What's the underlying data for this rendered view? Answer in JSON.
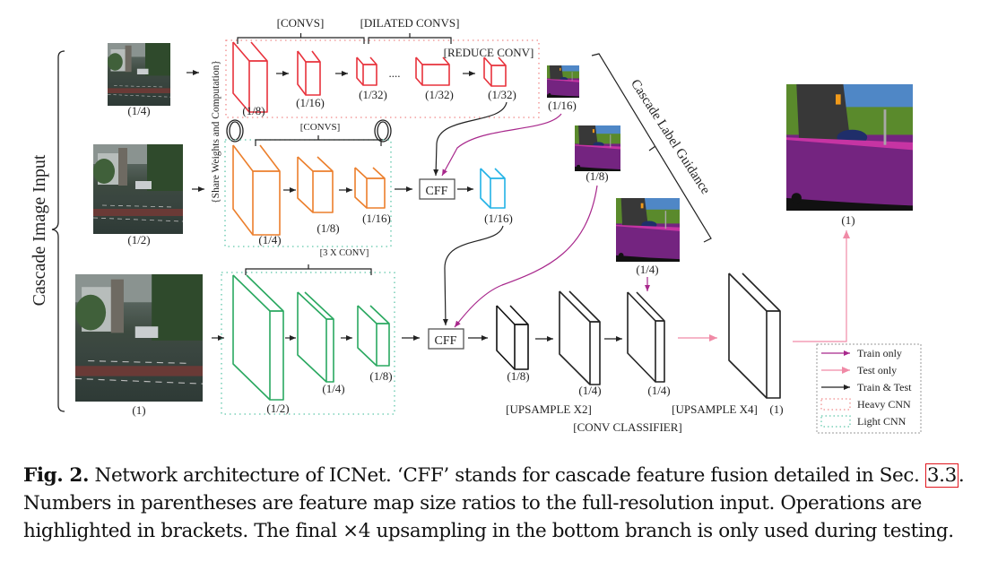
{
  "figure": {
    "colors": {
      "heavy_cnn": "#e8323c",
      "medium_cnn": "#ec7f2c",
      "light_cnn": "#2aa860",
      "cff_output": "#22b2e6",
      "classifier": "#111111",
      "train_only": "#a8288c",
      "test_only": "#f08aa6",
      "train_and_test": "#222222",
      "heavy_border": "#f08a8a",
      "light_border": "#5fc7aa"
    },
    "side_labels": {
      "cascade_image_input": "Cascade Image Input",
      "share_weights": "{Share Weights and Computation}",
      "cascade_label_guidance": "Cascade Label Guidance"
    },
    "inputs": [
      {
        "name": "input-quarter",
        "ratio": "(1/4)"
      },
      {
        "name": "input-half",
        "ratio": "(1/2)"
      },
      {
        "name": "input-full",
        "ratio": "(1)"
      }
    ],
    "top_branch": {
      "ops": [
        "[CONVS]",
        "[DILATED CONVS]",
        "[REDUCE CONV]"
      ],
      "ratios": [
        "(1/8)",
        "(1/16)",
        "(1/32)",
        "(1/32)",
        "(1/32)"
      ],
      "ellipsis": "....",
      "label_map_ratio": "(1/16)"
    },
    "middle_branch": {
      "op": "[CONVS]",
      "ratios": [
        "(1/4)",
        "(1/8)",
        "(1/16)"
      ],
      "cff": "CFF",
      "output_ratio": "(1/16)",
      "label_map_ratio": "(1/8)"
    },
    "bottom_branch": {
      "op": "[3 X CONV]",
      "ratios": [
        "(1/2)",
        "(1/4)",
        "(1/8)"
      ],
      "cff": "CFF",
      "label_map_ratio": "(1/4)",
      "decoder_ratios": [
        "(1/8)",
        "(1/4)",
        "(1/4)",
        "(1)"
      ],
      "decoder_ops": [
        "[UPSAMPLE X2]",
        "[CONV CLASSIFIER]",
        "[UPSAMPLE X4]"
      ]
    },
    "output": {
      "ratio": "(1)"
    },
    "legend": [
      {
        "label": "Train only",
        "kind": "arrow",
        "color": "#a8288c"
      },
      {
        "label": "Test only",
        "kind": "arrow",
        "color": "#f08aa6"
      },
      {
        "label": "Train & Test",
        "kind": "arrow",
        "color": "#222222"
      },
      {
        "label": "Heavy CNN",
        "kind": "box",
        "color": "#f08a8a"
      },
      {
        "label": "Light CNN",
        "kind": "box",
        "color": "#5fc7aa"
      }
    ]
  },
  "caption": {
    "fig_label": "Fig. 2.",
    "text_1": " Network architecture of ICNet. ‘CFF’ stands for cascade feature fusion detailed in Sec. ",
    "section_ref": "3.3",
    "text_2": ". Numbers in parentheses are feature map size ratios to the full-resolution input. Operations are highlighted in brackets. The final ×4 upsampling in the bottom branch is only used during testing."
  }
}
